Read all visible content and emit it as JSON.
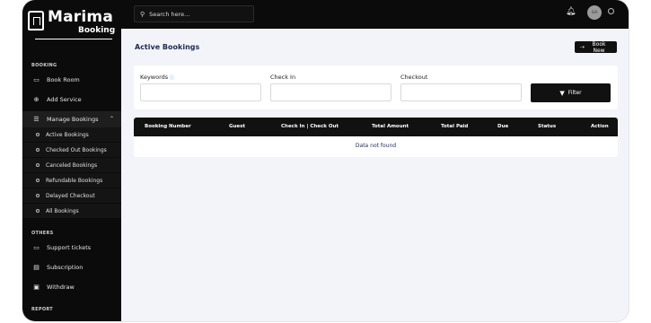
{
  "brand": {
    "name": "Marima",
    "sub": "Booking"
  },
  "sidebar": {
    "sections": {
      "booking": "BOOKING",
      "others": "OTHERS",
      "report": "REPORT"
    },
    "items": [
      {
        "label": "Book Room",
        "icon": "bed-icon"
      },
      {
        "label": "Add Service",
        "icon": "plus-circle-icon"
      },
      {
        "label": "Manage Bookings",
        "icon": "list-icon"
      }
    ],
    "submenu": [
      "Active Bookings",
      "Checked Out Bookings",
      "Canceled Bookings",
      "Refundable Bookings",
      "Delayed Checkout",
      "All Bookings"
    ],
    "others": [
      {
        "label": "Support tickets",
        "icon": "ticket-icon"
      },
      {
        "label": "Subscription",
        "icon": "card-icon"
      },
      {
        "label": "Withdraw",
        "icon": "wallet-icon"
      }
    ]
  },
  "topbar": {
    "search_placeholder": "Search here...",
    "avatar_initials": "GA"
  },
  "main": {
    "title": "Active Bookings",
    "book_new": "Book New",
    "filters": {
      "keywords": "Keywords",
      "check_in": "Check In",
      "checkout": "Checkout",
      "button": "Filter"
    },
    "table": {
      "columns": [
        "Booking Number",
        "Guest",
        "Check In | Check Out",
        "Total Amount",
        "Total Paid",
        "Due",
        "Status",
        "Action"
      ],
      "empty": "Data not found"
    }
  }
}
